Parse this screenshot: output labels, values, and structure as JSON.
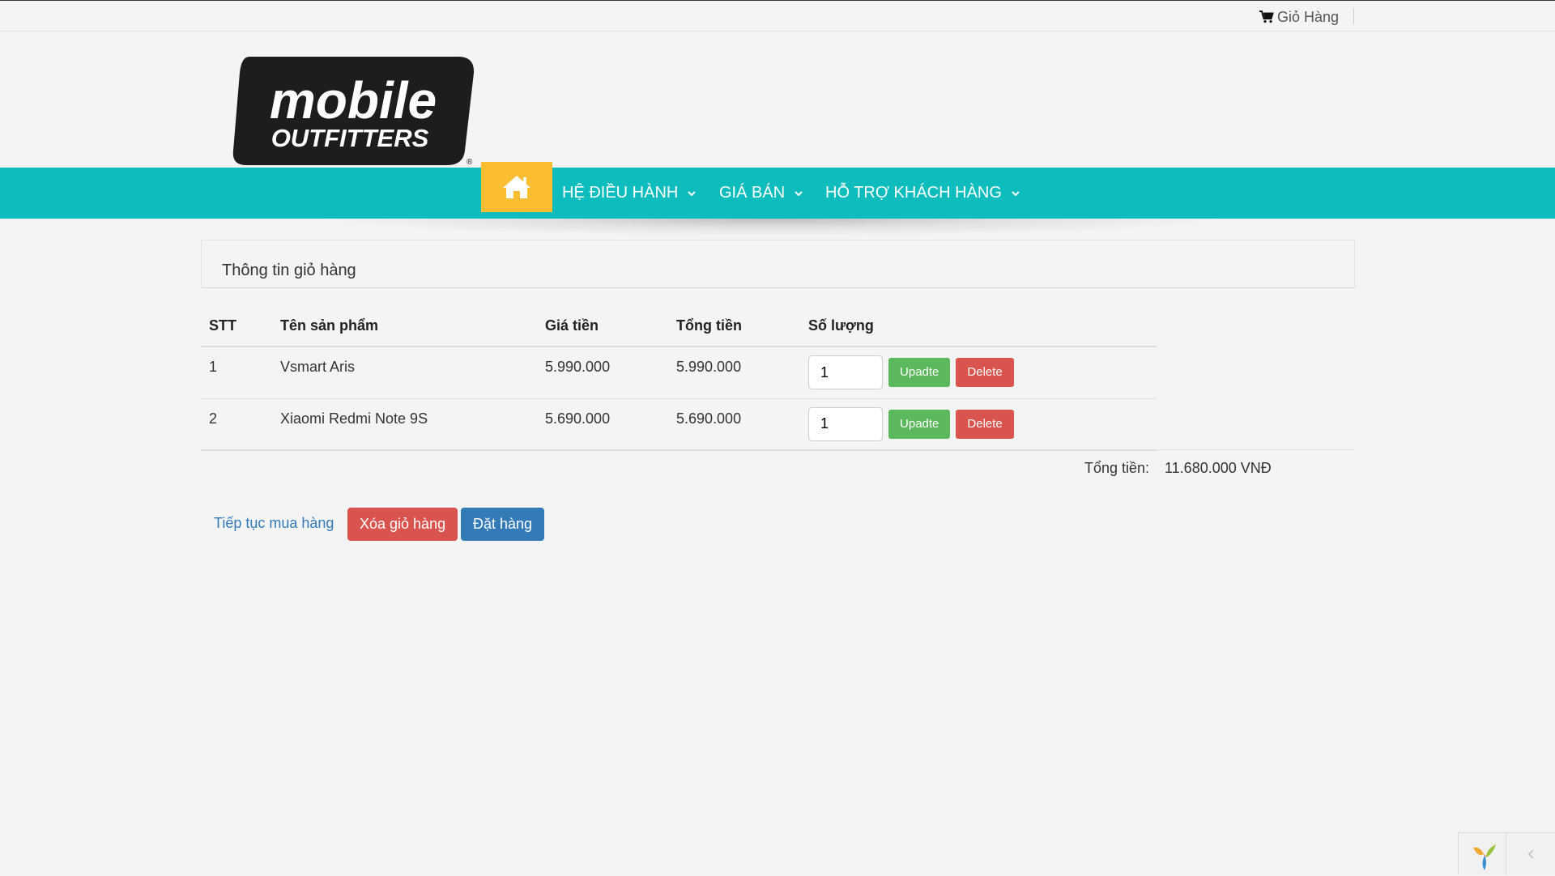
{
  "topbar": {
    "cart_label": "Giỏ Hàng",
    "cart_icon": "shopping-cart-icon"
  },
  "brand": {
    "logo_line1": "mobile",
    "logo_line2": "OUTFITTERS",
    "colors": {
      "nav_bg": "#0dbcbc",
      "home_bg": "#fbbd31"
    }
  },
  "nav": {
    "home_icon": "home-icon",
    "items": [
      {
        "label": "HỆ ĐIỀU HÀNH"
      },
      {
        "label": "GIÁ BÁN"
      },
      {
        "label": "HỖ TRỢ KHÁCH HÀNG"
      }
    ]
  },
  "panel": {
    "title": "Thông tin giỏ hàng"
  },
  "table": {
    "headers": [
      "STT",
      "Tên sản phẩm",
      "Giá tiền",
      "Tổng tiền",
      "Số lượng"
    ],
    "rows": [
      {
        "stt": "1",
        "name": "Vsmart Aris",
        "price": "5.990.000",
        "total": "5.990.000",
        "qty": "1"
      },
      {
        "stt": "2",
        "name": "Xiaomi Redmi Note 9S",
        "price": "5.690.000",
        "total": "5.690.000",
        "qty": "1"
      }
    ],
    "update_label": "Upadte",
    "delete_label": "Delete"
  },
  "summary": {
    "total_label": "Tổng tiền:",
    "total_value": "11.680.000 VNĐ"
  },
  "actions": {
    "continue_label": "Tiếp tục mua hàng",
    "clear_label": "Xóa giỏ hàng",
    "order_label": "Đặt hàng"
  },
  "debug": {
    "logo_icon": "yii-logo-icon",
    "toggle_icon": "chevron-left-icon"
  }
}
